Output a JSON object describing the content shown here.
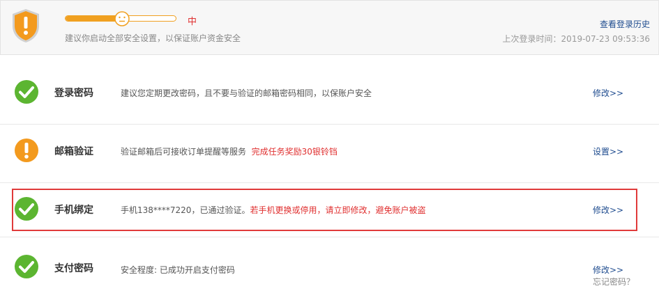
{
  "header": {
    "level_label": "中",
    "level_value": 0.52,
    "tip": "建议你启动全部安全设置，以保证账户资金安全",
    "history_link": "查看登录历史",
    "last_login": "上次登录时间：2019-07-23 09:53:36",
    "shield_icon": "exclamation-shield-icon",
    "accent_color": "#f0a020"
  },
  "items": [
    {
      "status": "ok",
      "title": "登录密码",
      "desc": "建议您定期更改密码，且不要与验证的邮箱密码相同，以保账户安全",
      "warn": "",
      "action": "修改>>"
    },
    {
      "status": "warn",
      "title": "邮箱验证",
      "desc": "验证邮箱后可接收订单提醒等服务",
      "warn": "完成任务奖励30银铃铛",
      "action": "设置>>"
    },
    {
      "status": "ok",
      "title": "手机绑定",
      "desc": "手机138****7220，已通过验证。",
      "warn": "若手机更换或停用，请立即修改，避免账户被盗",
      "action": "修改>>"
    },
    {
      "status": "ok",
      "title": "支付密码",
      "desc": "安全程度: 已成功开启支付密码",
      "warn": "",
      "action": "修改>>",
      "action2": "忘记密码？"
    }
  ],
  "colors": {
    "ok": "#5cb531",
    "warn": "#f39a1e",
    "link": "#1f4c8f",
    "alert": "#e03030"
  }
}
